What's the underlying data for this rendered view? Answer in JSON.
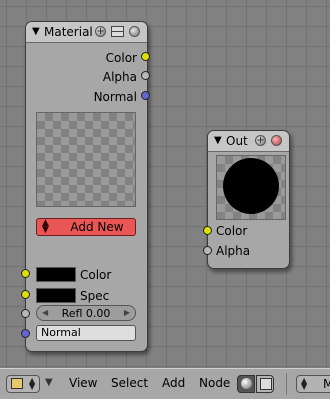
{
  "material_node": {
    "title": "Material",
    "outputs": [
      "Color",
      "Alpha",
      "Normal"
    ],
    "add_new_label": "Add New",
    "inputs": {
      "color_label": "Color",
      "spec_label": "Spec",
      "refl_label": "Refl 0.00",
      "normal_label": "Normal"
    }
  },
  "out_node": {
    "title": "Out",
    "inputs": [
      "Color",
      "Alpha"
    ]
  },
  "header": {
    "menus": [
      "View",
      "Select",
      "Add",
      "Node"
    ],
    "material_selector_text": "M"
  },
  "colors": {
    "socket_yellow": "#dede00",
    "socket_gray": "#b8b8b8",
    "socket_blue": "#6464d2",
    "add_new_button": "#ea5555"
  }
}
